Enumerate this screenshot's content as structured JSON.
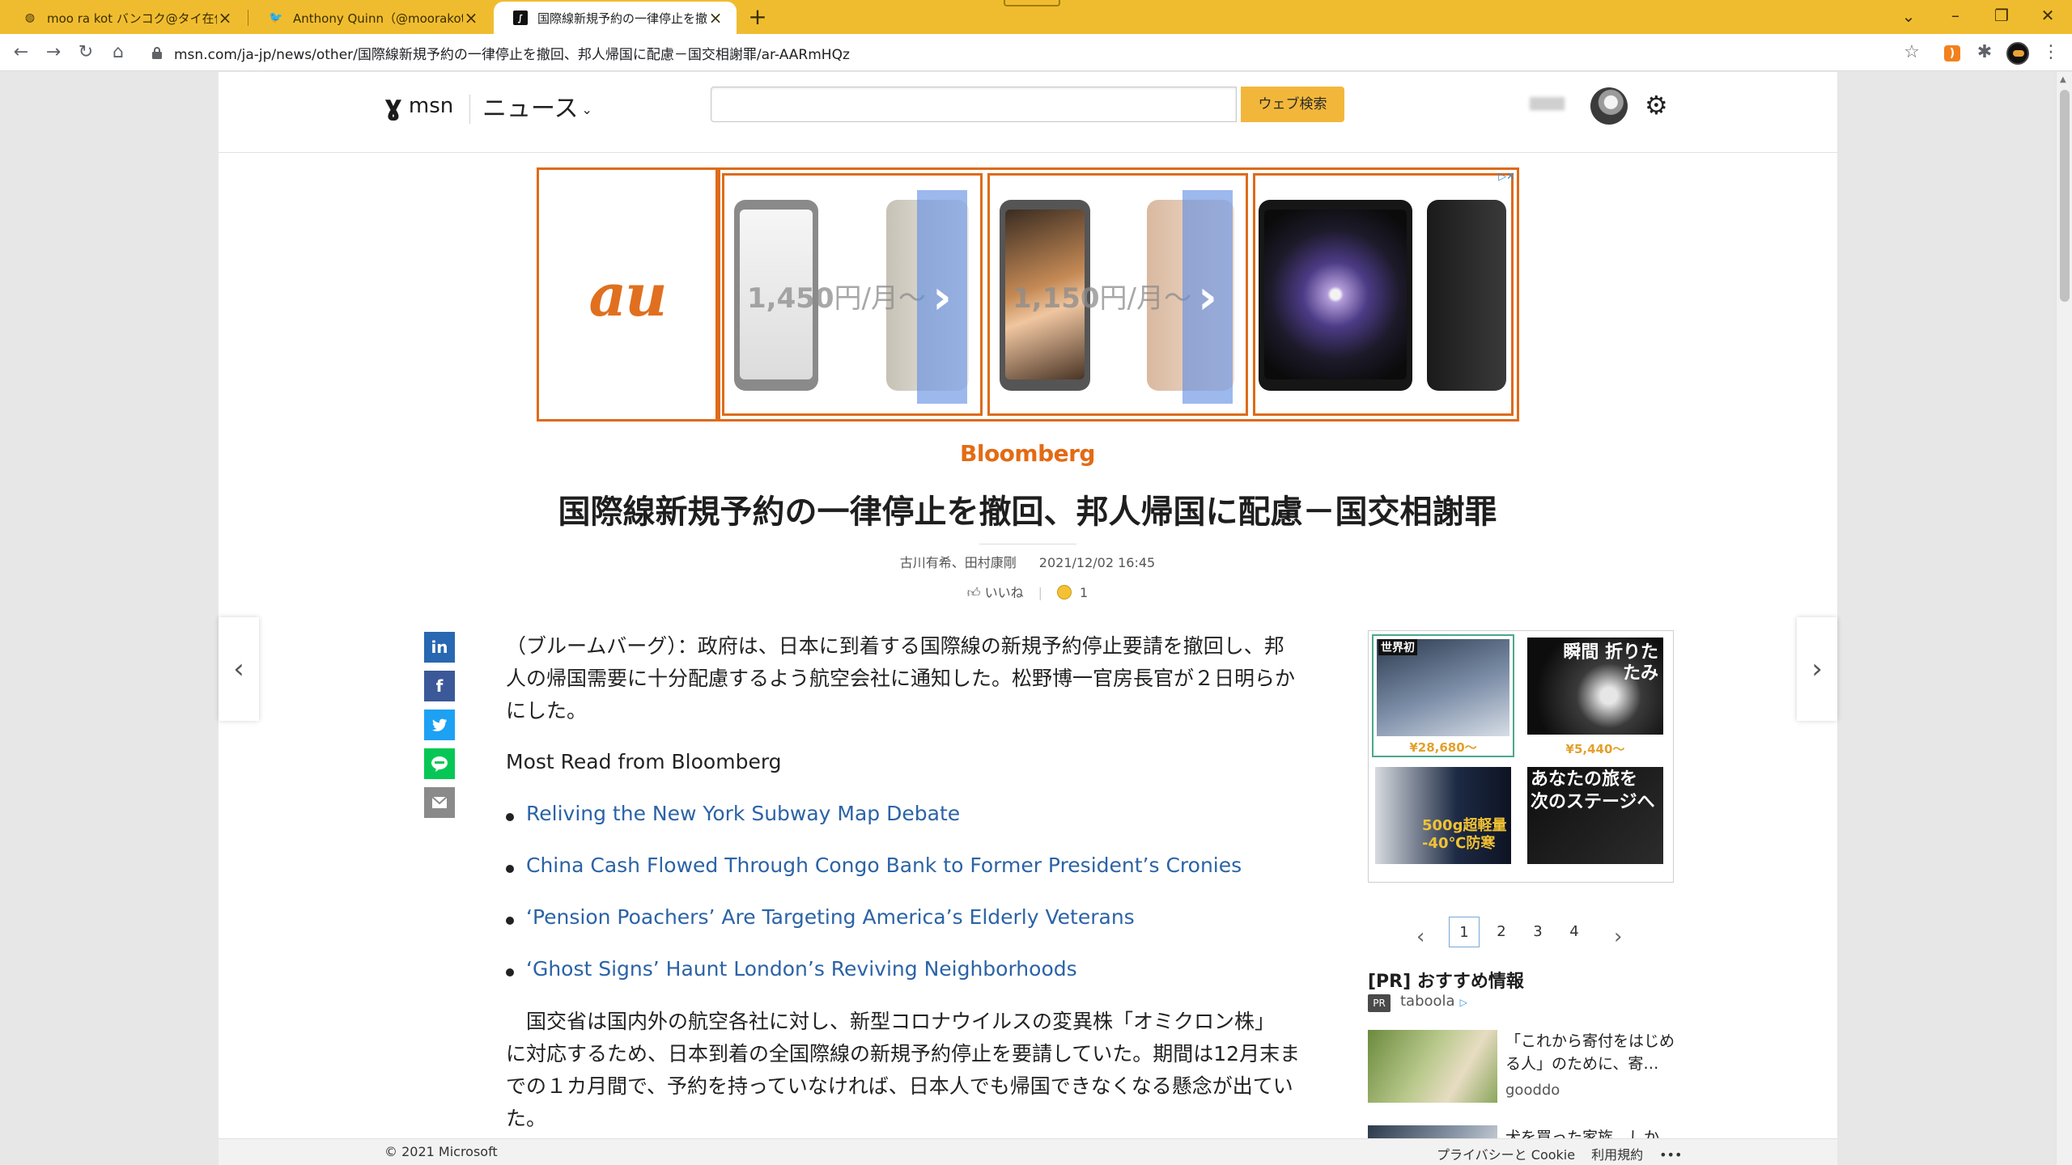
{
  "browser": {
    "tabs": [
      {
        "title": "moo ra kot バンコク@タイ在住／旅"
      },
      {
        "title": "Anthony Quinn（@moorakot）さん"
      },
      {
        "title": "国際線新規予約の一律停止を撤回"
      }
    ],
    "url": "msn.com/ja-jp/news/other/国際線新規予約の一律停止を撤回、邦人帰国に配慮－国交相謝罪/ar-AARmHQz",
    "icons": {
      "back": "arrow-left-icon",
      "forward": "arrow-right-icon",
      "reload": "reload-icon",
      "home": "home-icon",
      "bookmark": "star-icon",
      "extensions": "puzzle-icon",
      "menu": "kebab-icon"
    }
  },
  "msn_header": {
    "logo": "msn",
    "news_menu": "ニュース",
    "search_placeholder": "",
    "search_button": "ウェブ検索"
  },
  "ad": {
    "brand": "au",
    "price1": "1,450",
    "price2": "1,150",
    "price_unit": "円/月～",
    "arrow": "›",
    "adchoices": "▷✕",
    "colors": {
      "brand": "#e0701f"
    }
  },
  "article": {
    "source": "Bloomberg",
    "headline": "国際線新規予約の一律停止を撤回、邦人帰国に配慮－国交相謝罪",
    "authors": "古川有希、田村康剛",
    "datetime": "2021/12/02 16:45",
    "like_label": "いいね",
    "reaction_count": "1",
    "lead_line1": "（ブルームバーグ）：政府は、日本に到着する国際線の新規予約停止要請を撤回し、邦",
    "lead_line2": "人の帰国需要に十分配慮するよう航空会社に通知した。松野博一官房長官が２日明らか",
    "lead_line3": "にした。",
    "most_read_heading": "Most Read from Bloomberg",
    "most_read": [
      "Reliving the New York Subway Map Debate",
      "China Cash Flowed Through Congo Bank to Former President’s Cronies",
      "‘Pension Poachers’ Are Targeting America’s Elderly Veterans",
      "‘Ghost Signs’ Haunt London’s Reviving Neighborhoods"
    ],
    "para2_line1": "　国交省は国内外の航空各社に対し、新型コロナウイルスの変異株「オミクロン株」",
    "para2_line2": "に対応するため、日本到着の全国際線の新規予約停止を要請していた。期間は12月末ま",
    "para2_line3": "での１カ月間で、予約を持っていなければ、日本人でも帰国できなくなる懸念が出てい",
    "para2_line4": "た。"
  },
  "share": {
    "linkedin": "in",
    "facebook": "f",
    "twitter": "t",
    "line": "line-icon",
    "email": "mail-icon"
  },
  "side_ad": {
    "tiles": [
      {
        "caption": "世界初",
        "price": "¥28,680～"
      },
      {
        "caption": "瞬間 折りたたみ",
        "price": "¥5,440～"
      },
      {
        "caption": "500g超軽量 -40℃防寒",
        "price": ""
      },
      {
        "caption": "あなたの旅を 次のステージへ",
        "price": ""
      }
    ]
  },
  "pager": {
    "pages": [
      "1",
      "2",
      "3",
      "4"
    ],
    "current": "1"
  },
  "recommend": {
    "title": "[PR] おすすめ情報",
    "badge": "PR",
    "provider": "taboola",
    "story1_title": "「これから寄付をはじめる人」のために、寄…",
    "story1_source": "gooddo",
    "story2_title": "犬を買った家族、しか…"
  },
  "footer": {
    "copyright": "© 2021 Microsoft",
    "privacy": "プライバシーと Cookie",
    "terms": "利用規約",
    "more": "•••"
  }
}
